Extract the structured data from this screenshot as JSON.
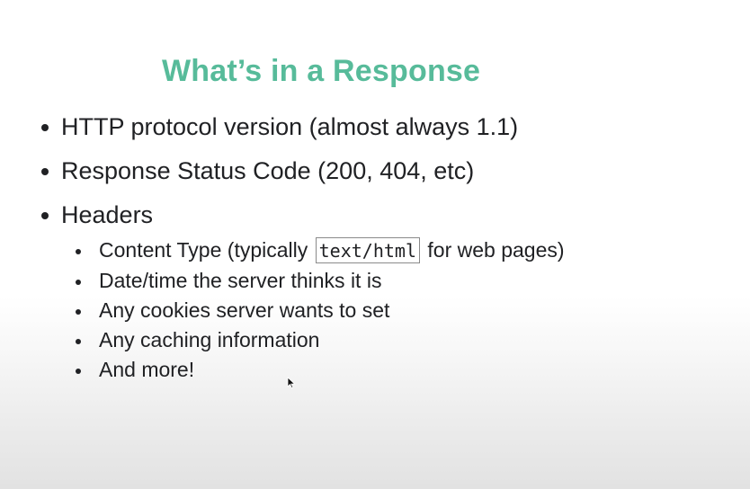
{
  "slide": {
    "title": "What’s in a Response",
    "bullets": [
      {
        "text": "HTTP protocol version (almost always 1.1)"
      },
      {
        "text": "Response Status Code (200, 404, etc)"
      },
      {
        "text": "Headers"
      }
    ],
    "subbullets": [
      {
        "before": "Content Type (typically ",
        "code": "text/html",
        "after": " for web pages)"
      },
      {
        "text": "Date/time the server thinks it is"
      },
      {
        "text": "Any cookies server wants to set"
      },
      {
        "text": "Any caching information"
      },
      {
        "text": "And more!"
      }
    ]
  },
  "colors": {
    "title": "#57bb9a",
    "text": "#202124"
  },
  "icons": {
    "cursor": "mouse-pointer-icon"
  }
}
